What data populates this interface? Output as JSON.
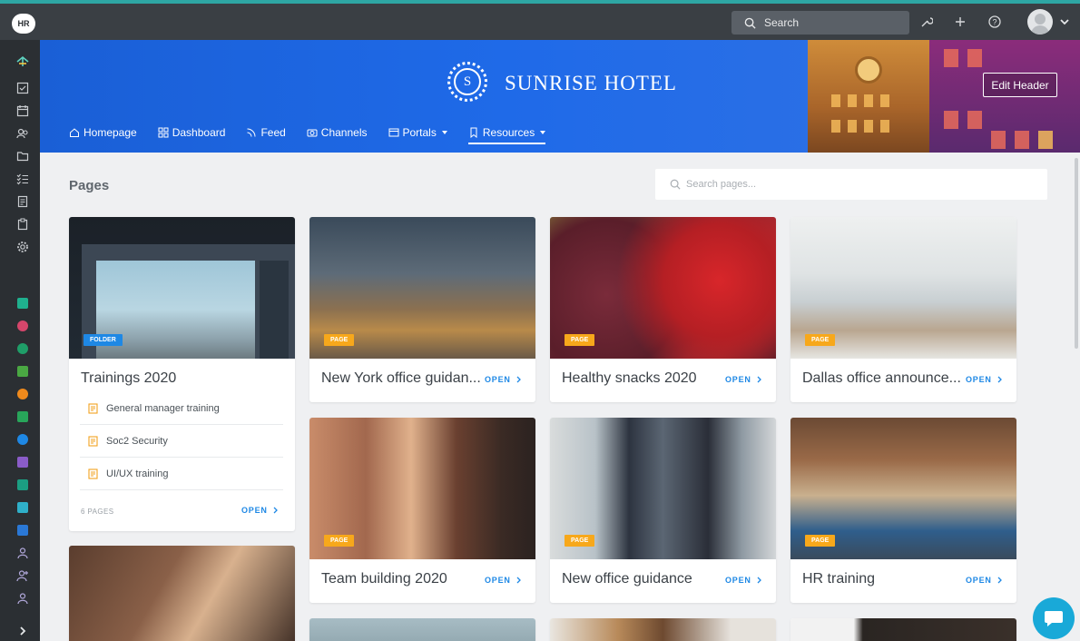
{
  "topbar": {
    "org_badge": "HR",
    "search_label": "Search",
    "icons": [
      "wrench-icon",
      "plus-icon",
      "help-icon",
      "avatar",
      "chevron-down-icon"
    ]
  },
  "rail": {
    "icons": [
      "home-icon",
      "tasks-icon",
      "calendar-icon",
      "people-icon",
      "folder-icon",
      "checklist-icon",
      "document-icon",
      "clipboard-icon",
      "settings-icon"
    ],
    "apps": [
      "#1fb08e",
      "#d5466b",
      "#1f9e68",
      "#4aa843",
      "#f08a1c",
      "#28a55a",
      "#1e88e5",
      "#8a5cc8",
      "#1b9e82",
      "#2fb0c9",
      "#2a78d6"
    ],
    "expand_icon": "chevron-right-icon"
  },
  "header": {
    "logo_letter": "S",
    "hotel_name": "SUNRISE HOTEL",
    "edit_button": "Edit Header",
    "nav": [
      {
        "label": "Homepage",
        "icon": "home-icon"
      },
      {
        "label": "Dashboard",
        "icon": "grid-icon"
      },
      {
        "label": "Feed",
        "icon": "rss-icon"
      },
      {
        "label": "Channels",
        "icon": "channels-icon"
      },
      {
        "label": "Portals",
        "icon": "portal-icon"
      },
      {
        "label": "Resources",
        "icon": "bookmark-icon"
      }
    ]
  },
  "pages": {
    "title": "Pages",
    "search_placeholder": "Search pages...",
    "folder_card": {
      "badge": "FOLDER",
      "title": "Trainings 2020",
      "items": [
        "General manager training",
        "Soc2 Security",
        "UI/UX training"
      ],
      "count": "6 PAGES",
      "open": "OPEN"
    },
    "cards": [
      {
        "badge": "PAGE",
        "title": "New York office guidan...",
        "open": "OPEN"
      },
      {
        "badge": "PAGE",
        "title": "Healthy snacks 2020",
        "open": "OPEN"
      },
      {
        "badge": "PAGE",
        "title": "Dallas office announce...",
        "open": "OPEN"
      },
      {
        "badge": "PAGE",
        "title": "Team building 2020",
        "open": "OPEN"
      },
      {
        "badge": "PAGE",
        "title": "New office guidance",
        "open": "OPEN"
      },
      {
        "badge": "PAGE",
        "title": "HR training",
        "open": "OPEN"
      }
    ]
  },
  "colors": {
    "accent": "#1e88e5",
    "badge_page": "#f7a81b",
    "badge_folder": "#1e88e5",
    "banner": "#1f6ae8",
    "chat": "#19a9d8"
  }
}
